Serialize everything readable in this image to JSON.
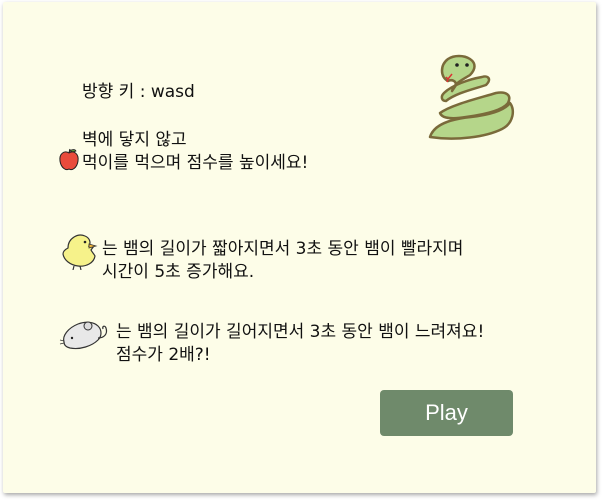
{
  "instructions": {
    "keys": "방향 키 : wasd",
    "avoid_wall": "벽에 닿지 않고",
    "eat_food": "먹이를 먹으며 점수를 높이세요!"
  },
  "items": [
    {
      "icon": "chick-icon",
      "line1": "는 뱀의 길이가 짧아지면서 3초 동안 뱀이 빨라지며",
      "line2": "시간이 5초 증가해요."
    },
    {
      "icon": "mouse-icon",
      "line1": "는 뱀의 길이가 길어지면서 3초 동안 뱀이 느려져요!",
      "line2": "점수가 2배?!"
    }
  ],
  "play_button": {
    "label": "Play"
  },
  "colors": {
    "background": "#fdfde8",
    "button": "#6f8a6b",
    "snake": "#b5d68a",
    "apple": "#e94b3c",
    "chick": "#f6f28a"
  }
}
